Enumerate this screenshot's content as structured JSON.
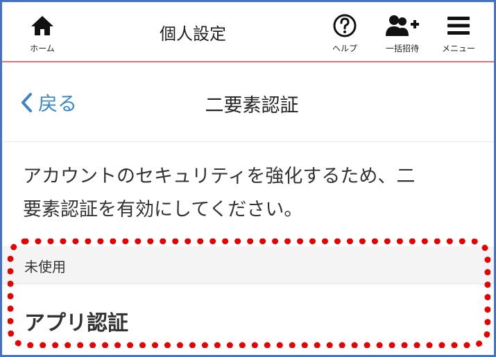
{
  "header": {
    "title": "個人設定",
    "home_label": "ホーム",
    "help_label": "ヘルプ",
    "invite_label": "一括招待",
    "menu_label": "メニュー"
  },
  "subheader": {
    "back_label": "戻る",
    "title": "二要素認証"
  },
  "description": {
    "line1": "アカウントのセキュリティを強化するため、二",
    "line2": "要素認証を有効にしてください。"
  },
  "status": {
    "label": "未使用"
  },
  "auth_option": {
    "label": "アプリ認証"
  },
  "colors": {
    "accent": "#3d86c6",
    "header_border": "#e8707a",
    "highlight": "#e60000",
    "frame": "#4472c4"
  },
  "icons": [
    "home-icon",
    "help-icon",
    "invite-users-icon",
    "menu-icon",
    "chevron-left-icon"
  ]
}
